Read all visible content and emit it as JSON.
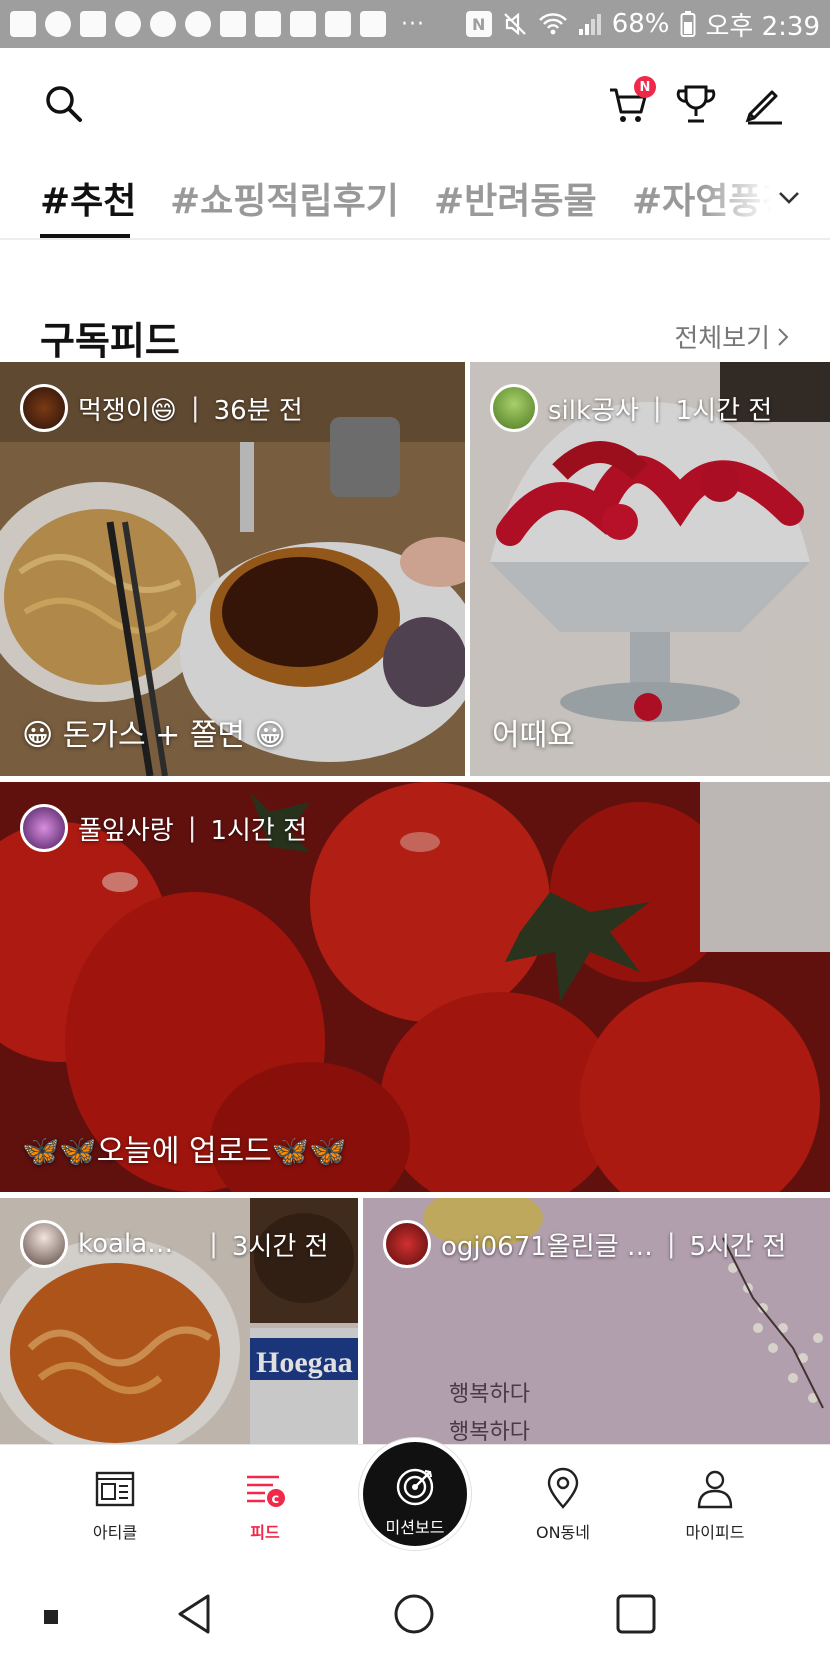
{
  "status_bar": {
    "nfc": "N",
    "battery": "68%",
    "time": "오후 2:39"
  },
  "header": {
    "cart_badge": "N"
  },
  "tabs": [
    {
      "label": "#추천",
      "active": true
    },
    {
      "label": "#쇼핑적립후기",
      "active": false
    },
    {
      "label": "#반려동물",
      "active": false
    },
    {
      "label": "#자연풍경",
      "active": false
    }
  ],
  "section": {
    "title": "구독피드",
    "see_all": "전체보기"
  },
  "cards": [
    {
      "user": "먹쟁이😄",
      "time": "36분 전",
      "caption": "😀 돈가스 + 쫄면 😀"
    },
    {
      "user": "silk공사",
      "time": "1시간 전",
      "caption": "어때요"
    },
    {
      "user": "풀잎사랑",
      "time": "1시간 전",
      "caption": "🦋🦋오늘에 업로드🦋🦋"
    },
    {
      "user": "koala…",
      "time": "3시간 전",
      "caption": ""
    },
    {
      "user": "ogj0671올린글 …",
      "time": "5시간 전",
      "caption": ""
    }
  ],
  "card5_text": [
    "행복하다",
    "행복하다"
  ],
  "bottom_nav": {
    "article": "아티클",
    "feed": "피드",
    "mission": "미션보드",
    "on_town": "ON동네",
    "my_feed": "마이피드"
  },
  "colors": {
    "accent": "#f0284a",
    "status_bar": "#9e9e9e"
  }
}
